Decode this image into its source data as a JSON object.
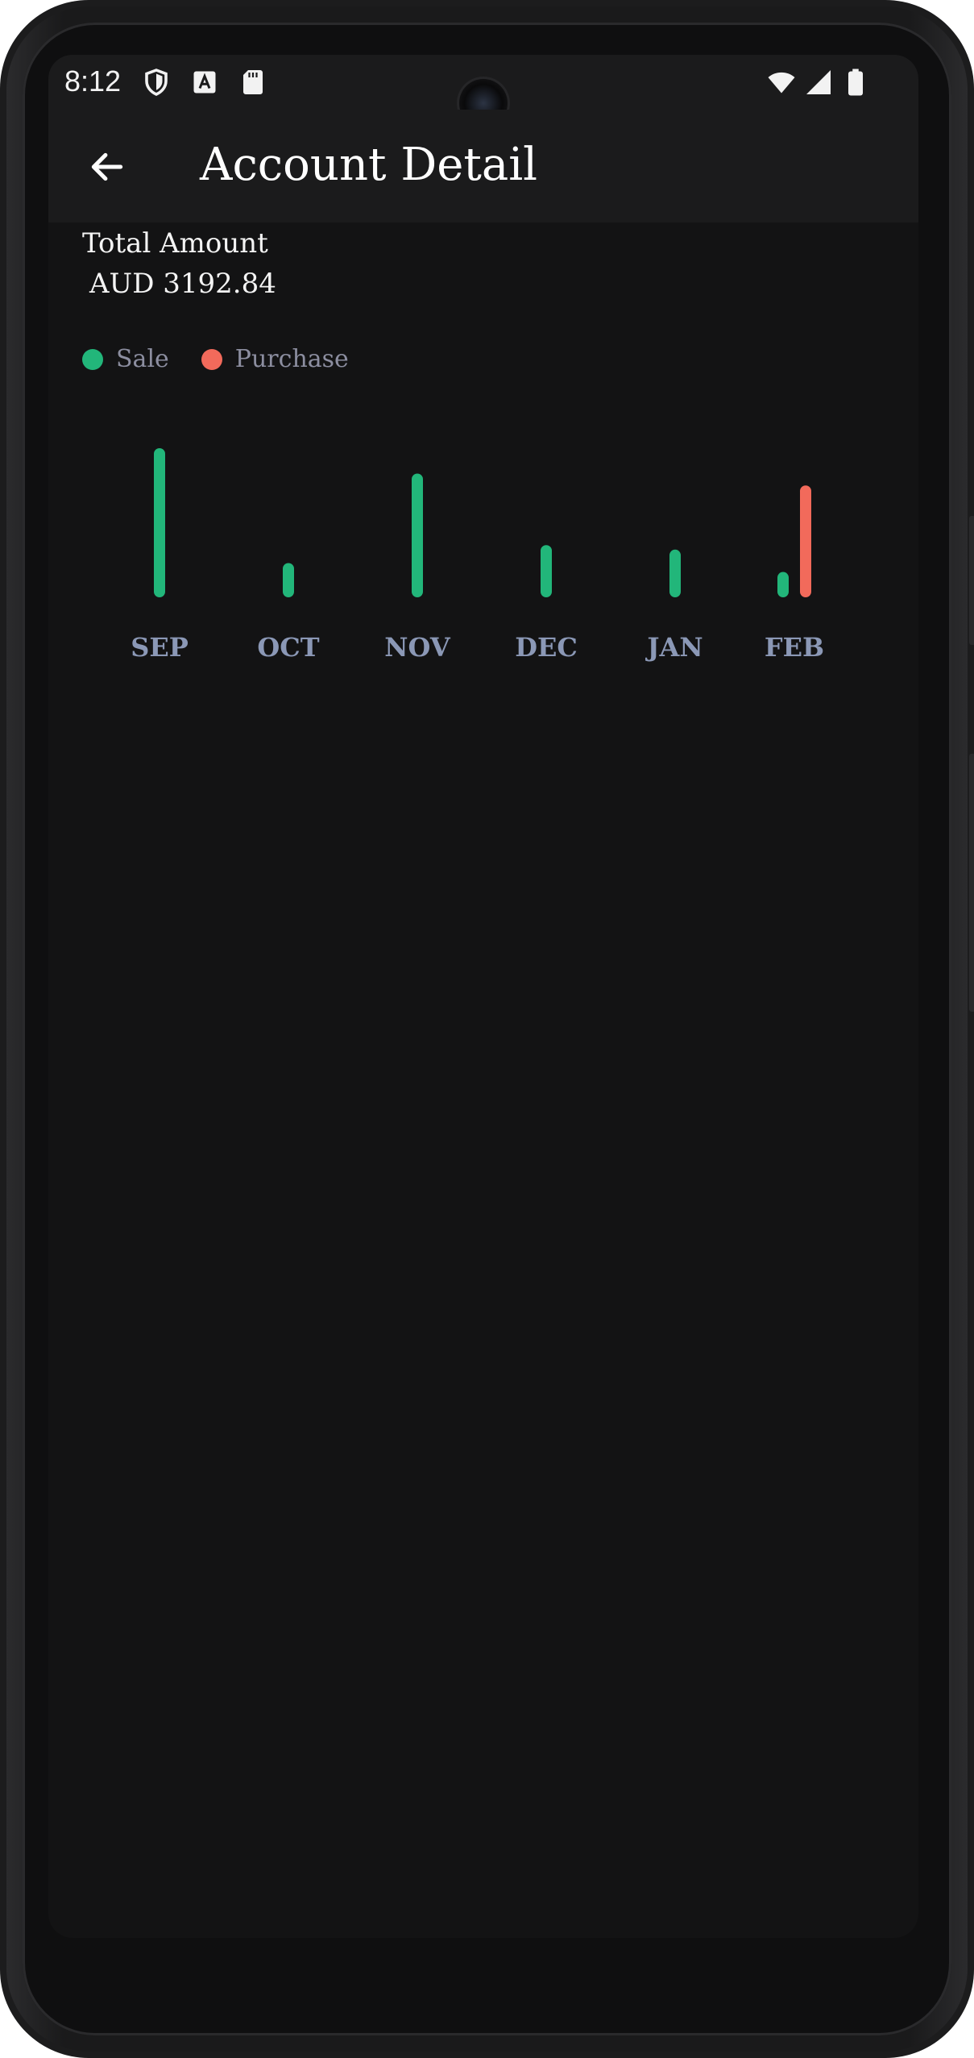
{
  "status_bar": {
    "time": "8:12",
    "left_icons": [
      "shield-icon",
      "font-a-icon",
      "sd-card-icon"
    ],
    "right_icons": [
      "wifi-icon",
      "signal-icon",
      "battery-icon"
    ]
  },
  "app_bar": {
    "back_icon": "arrow-left-icon",
    "title": "Account Detail"
  },
  "summary": {
    "label": "Total Amount",
    "value": "AUD 3192.84"
  },
  "legend": {
    "sale": "Sale",
    "purchase": "Purchase"
  },
  "colors": {
    "sale": "#22b67a",
    "purchase": "#f26a5b",
    "axis_label": "#8b98b6",
    "background": "#131314"
  },
  "chart_data": {
    "type": "bar",
    "categories": [
      "SEP",
      "OCT",
      "NOV",
      "DEC",
      "JAN",
      "FEB"
    ],
    "series": [
      {
        "name": "Sale",
        "values": [
          100,
          23,
          83,
          35,
          32,
          17
        ]
      },
      {
        "name": "Purchase",
        "values": [
          0,
          0,
          0,
          0,
          0,
          75
        ]
      }
    ],
    "ylim": [
      0,
      100
    ],
    "grid": false,
    "legend_placement": "top-left"
  }
}
